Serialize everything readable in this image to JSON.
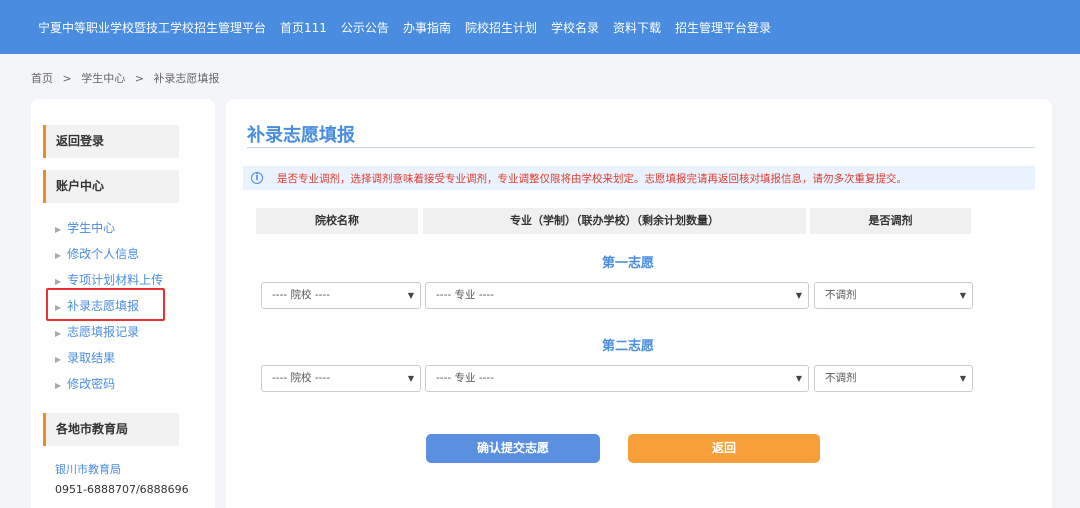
{
  "nav": {
    "site_title": "宁夏中等职业学校暨技工学校招生管理平台",
    "items": [
      "首页111",
      "公示公告",
      "办事指南",
      "院校招生计划",
      "学校名录",
      "资料下载",
      "招生管理平台登录"
    ]
  },
  "breadcrumb": [
    "首页",
    ">",
    "学生中心",
    ">",
    "补录志愿填报"
  ],
  "sidebar": {
    "back_login": "返回登录",
    "account_center": "账户中心",
    "links": [
      "学生中心",
      "修改个人信息",
      "专项计划材料上传",
      "补录志愿填报",
      "志愿填报记录",
      "录取结果",
      "修改密码"
    ],
    "edu_bureau_header": "各地市教育局",
    "bureau_name": "银川市教育局",
    "bureau_phone": "0951-6888707/6888696"
  },
  "main": {
    "title": "补录志愿填报",
    "notice": "是否专业调剂，选择调剂意味着接受专业调剂，专业调整仅限将由学校来划定。志愿填报完请再返回核对填报信息，请勿多次重复提交。",
    "headers": [
      "院校名称",
      "专业（学制）（联办学校）（剩余计划数量）",
      "是否调剂"
    ],
    "choices": [
      {
        "label": "第一志愿",
        "school": "---- 院校 ----",
        "major": "---- 专业 ----",
        "adjust": "不调剂"
      },
      {
        "label": "第二志愿",
        "school": "---- 院校 ----",
        "major": "---- 专业 ----",
        "adjust": "不调剂"
      }
    ],
    "submit_button": "确认提交志愿",
    "back_button": "返回"
  },
  "colors": {
    "primary": "#4a8de0",
    "accent": "#f7a03a",
    "warning_text": "#e03b2f",
    "highlight_box": "#e8322f"
  }
}
